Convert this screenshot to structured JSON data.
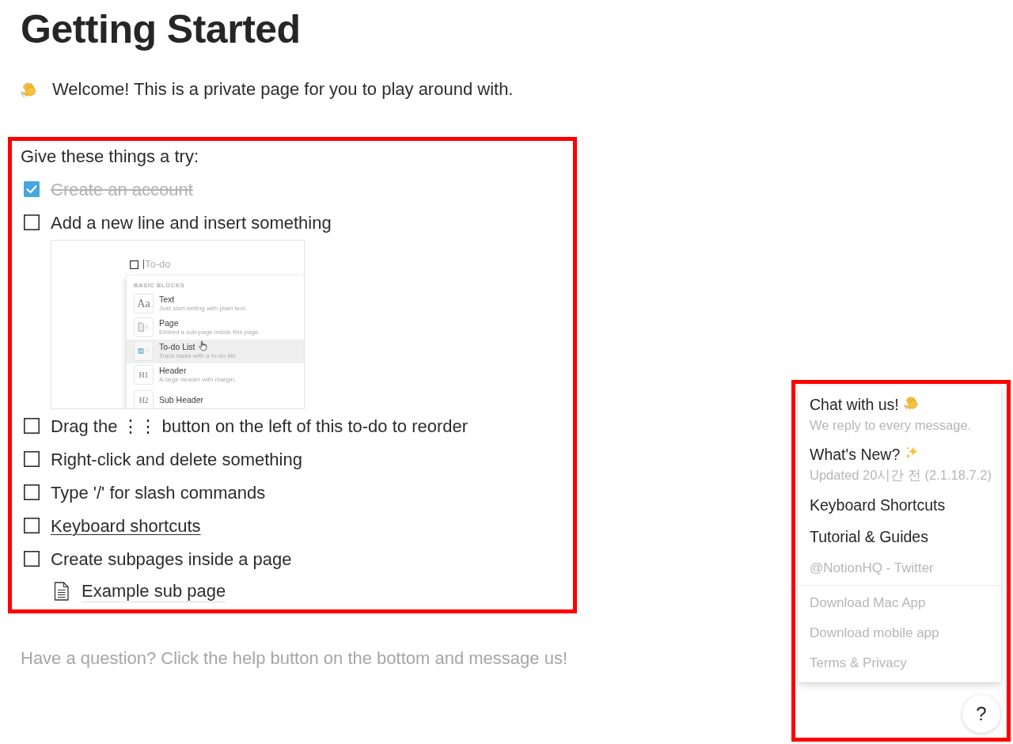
{
  "page": {
    "title": "Getting Started",
    "welcome": "Welcome! This is a private page for you to play around with."
  },
  "checklist": {
    "highlighted": true,
    "heading": "Give these things a try:",
    "items": [
      {
        "kind": "todo",
        "text": "Create an account",
        "checked": true,
        "link": false
      },
      {
        "kind": "todo",
        "text": "Add a new line and insert something",
        "checked": false,
        "link": false,
        "children": [
          {
            "kind": "screenshot",
            "block_input": {
              "placeholder": "To-do"
            },
            "menu": {
              "heading": "BASIC BLOCKS",
              "items": [
                {
                  "kind": "glyph",
                  "tile": "Aa",
                  "title": "Text",
                  "description": "Just start writing with plain text.",
                  "selected": false
                },
                {
                  "kind": "page",
                  "title": "Page",
                  "description": "Embed a sub-page inside this page.",
                  "selected": false
                },
                {
                  "kind": "todo",
                  "title": "To-do List",
                  "description": "Track tasks with a to-do list.",
                  "selected": true
                },
                {
                  "kind": "glyph",
                  "tile": "H1",
                  "title": "Header",
                  "description": "A large header with margin.",
                  "selected": false
                },
                {
                  "kind": "glyph",
                  "tile": "H2",
                  "title": "Sub Header",
                  "selected": false
                }
              ]
            }
          }
        ]
      },
      {
        "kind": "todo",
        "text": "Drag the ⋮⋮ button on the left of this to-do to reorder",
        "checked": false,
        "link": false
      },
      {
        "kind": "todo",
        "text": "Right-click and delete something",
        "checked": false,
        "link": false
      },
      {
        "kind": "todo",
        "text": "Type '/' for slash commands",
        "checked": false,
        "link": false
      },
      {
        "kind": "todo",
        "text": "Keyboard shortcuts",
        "checked": false,
        "link": true
      },
      {
        "kind": "todo",
        "text": "Create subpages inside a page",
        "checked": false,
        "link": false,
        "children": [
          {
            "kind": "page",
            "text": "Example sub page"
          }
        ]
      }
    ]
  },
  "footer_note": "Have a question? Click the help button on the bottom and message us!",
  "help_menu": {
    "highlighted": true,
    "sections": [
      [
        {
          "kind": "chat",
          "label": "Chat with us!",
          "detail": "We reply to every message.",
          "muted": false
        },
        {
          "kind": "news",
          "label": "What's New?",
          "detail": "Updated 20시간 전 (2.1.18.7.2)",
          "muted": false
        },
        {
          "kind": "link",
          "label": "Keyboard Shortcuts",
          "muted": false
        },
        {
          "kind": "link",
          "label": "Tutorial & Guides",
          "muted": false
        },
        {
          "kind": "link",
          "label": "@NotionHQ - Twitter",
          "muted": true
        }
      ],
      [
        {
          "kind": "link",
          "label": "Download Mac App",
          "muted": true
        },
        {
          "kind": "link",
          "label": "Download mobile app",
          "muted": true
        },
        {
          "kind": "link",
          "label": "Terms & Privacy",
          "muted": true
        }
      ]
    ]
  },
  "help_button": {
    "label": "?"
  }
}
